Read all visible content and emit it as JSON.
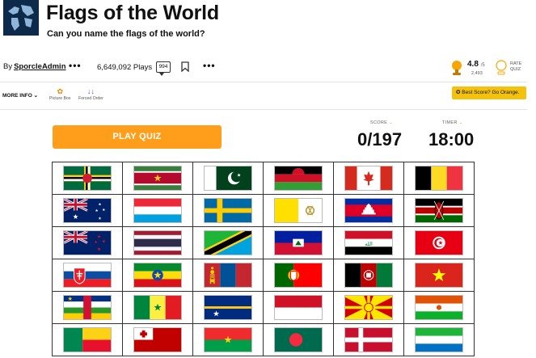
{
  "quiz": {
    "title": "Flags of the World",
    "subtitle": "Can you name the flags of the world?"
  },
  "meta": {
    "by_prefix": "By",
    "author": "SporcleAdmin",
    "plays": "6,649,092 Plays",
    "comments": "994",
    "rating": "4.8",
    "rating_scale": "/5",
    "rating_count": "2,493",
    "rate_label_1": "RATE",
    "rate_label_2": "QUIZ"
  },
  "toolbar": {
    "more_info": "MORE INFO",
    "picture_box": "Picture Box",
    "forced_order": "Forced Order",
    "best_score": "Best Score? Go Orange."
  },
  "game": {
    "play_label": "PLAY QUIZ",
    "score_label": "SCORE",
    "score": "0/197",
    "timer_label": "TIMER",
    "timer": "18:00"
  },
  "flags": [
    [
      "dominica",
      "suriname",
      "pakistan",
      "malawi",
      "canada",
      "belgium"
    ],
    [
      "australia",
      "luxembourg",
      "sweden",
      "vatican",
      "cambodia",
      "kenya"
    ],
    [
      "new-zealand",
      "thailand",
      "tanzania",
      "haiti",
      "iraq",
      "tunisia"
    ],
    [
      "slovakia",
      "ethiopia",
      "mongolia",
      "portugal",
      "afghanistan",
      "vietnam"
    ],
    [
      "central-african-republic",
      "senegal",
      "nauru",
      "indonesia",
      "north-macedonia",
      "niger"
    ],
    [
      "benin",
      "tonga",
      "burkina-faso",
      "bangladesh",
      "denmark",
      "sierra-leone"
    ]
  ],
  "colors": {
    "accent": "#ff9e1b",
    "best_bg": "#f4c20d",
    "thumb_bg": "#0e2a4a"
  }
}
